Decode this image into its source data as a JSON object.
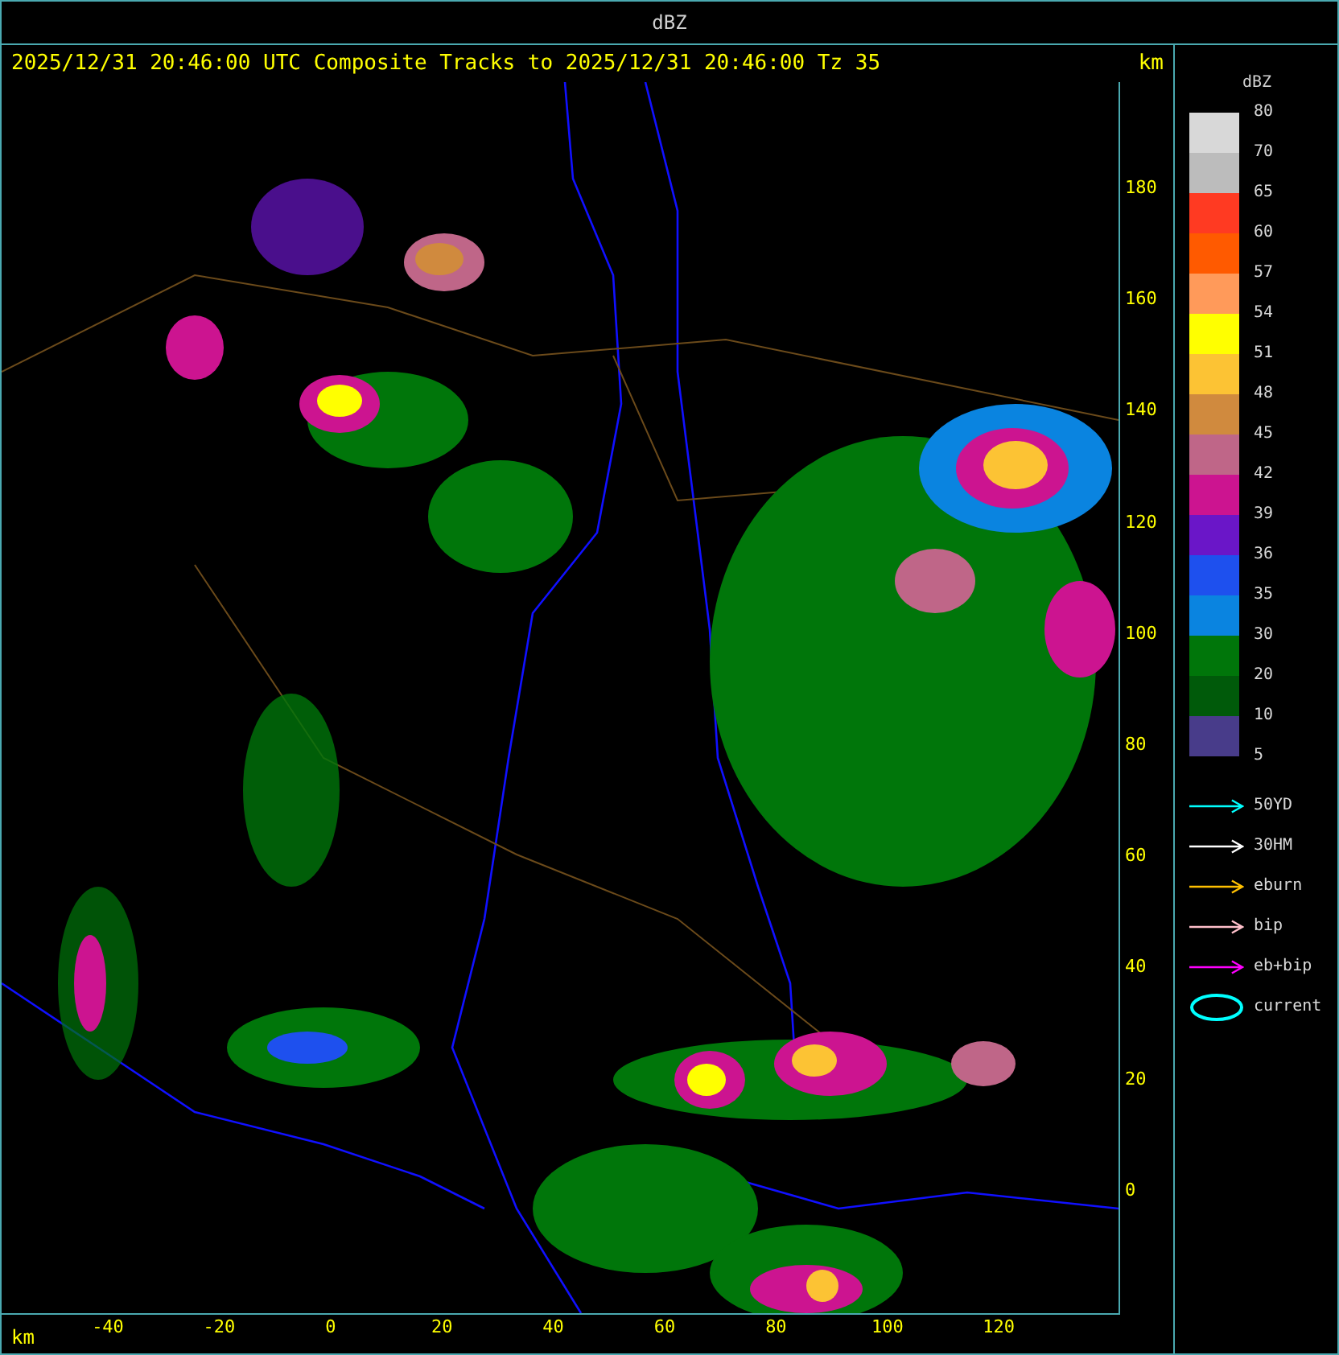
{
  "header": {
    "title": "dBZ"
  },
  "plot": {
    "title": "2025/12/31 20:46:00 UTC Composite Tracks to 2025/12/31 20:46:00 Tz 35",
    "y_axis": {
      "label": "km",
      "ticks": [
        "180",
        "160",
        "140",
        "120",
        "100",
        "80",
        "60",
        "40",
        "20",
        "0"
      ]
    },
    "x_axis": {
      "label": "km",
      "ticks": [
        "-40",
        "-20",
        "0",
        "20",
        "40",
        "60",
        "80",
        "100",
        "120"
      ]
    }
  },
  "legend": {
    "title": "dBZ",
    "bands": [
      {
        "label": "80",
        "color": "#d8d8d8"
      },
      {
        "label": "70",
        "color": "#bcbcbc"
      },
      {
        "label": "65",
        "color": "#ff3a22"
      },
      {
        "label": "60",
        "color": "#ff5a00"
      },
      {
        "label": "57",
        "color": "#ff9a5a"
      },
      {
        "label": "54",
        "color": "#ffff00"
      },
      {
        "label": "51",
        "color": "#fcc334"
      },
      {
        "label": "48",
        "color": "#d08a3e"
      },
      {
        "label": "45",
        "color": "#bf6688"
      },
      {
        "label": "42",
        "color": "#cc1490"
      },
      {
        "label": "39",
        "color": "#6a16c8"
      },
      {
        "label": "36",
        "color": "#1e50ee"
      },
      {
        "label": "35",
        "color": "#0a84e0"
      },
      {
        "label": "30",
        "color": "#00760a"
      },
      {
        "label": "20",
        "color": "#005a0a"
      },
      {
        "label": "10",
        "color": "#483c8a"
      }
    ],
    "last_label": "5",
    "tracks": [
      {
        "label": "50YD",
        "color": "#00ffff",
        "kind": "arrow"
      },
      {
        "label": "30HM",
        "color": "#ffffff",
        "kind": "arrow"
      },
      {
        "label": "eburn",
        "color": "#ffc000",
        "kind": "arrow"
      },
      {
        "label": "bip",
        "color": "#ffc0cb",
        "kind": "arrow"
      },
      {
        "label": "eb+bip",
        "color": "#ff00ff",
        "kind": "arrow"
      },
      {
        "label": "current",
        "color": "#00ffff",
        "kind": "ellipse"
      }
    ]
  }
}
